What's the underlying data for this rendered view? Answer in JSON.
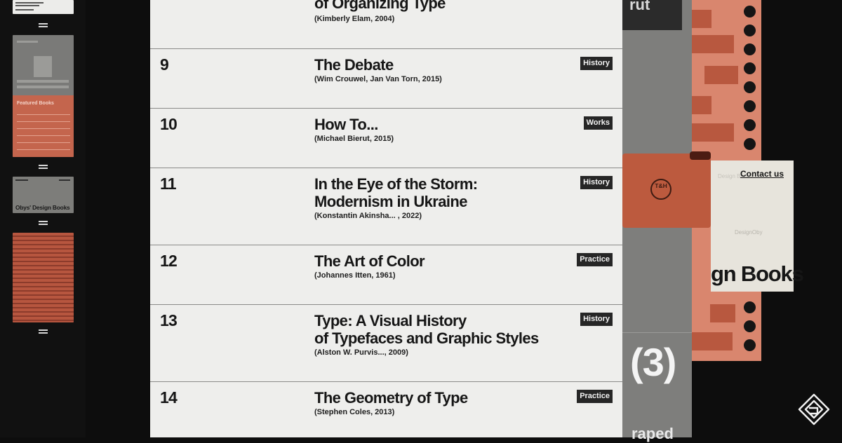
{
  "rail": {
    "thumb3_title": "Obys' Design Books",
    "thumb2_heading": "Featured Books"
  },
  "list": {
    "top": {
      "title": "of Organizing Type",
      "meta": "(Kimberly Elam, 2004)"
    },
    "books": [
      {
        "num": "9",
        "title": "The Debate",
        "meta": "(Wim Crouwel, Jan Van Torn, 2015)",
        "tag": "History"
      },
      {
        "num": "10",
        "title": "How To...",
        "meta": "(Michael Bierut, 2015)",
        "tag": "Works"
      },
      {
        "num": "11",
        "title": "In the Eye of the Storm:\nModernism in Ukraine",
        "meta": "(Konstantin Akinsha... , 2022)",
        "tag": "History"
      },
      {
        "num": "12",
        "title": "The Art of Color",
        "meta": "(Johannes Itten, 1961)",
        "tag": "Practice"
      },
      {
        "num": "13",
        "title": "Type: A Visual History\nof Typefaces and Graphic Styles",
        "meta": "(Alston W. Purvis..., 2009)",
        "tag": "History"
      },
      {
        "num": "14",
        "title": "The Geometry of Type",
        "meta": "(Stephen Coles, 2013)",
        "tag": "Practice"
      }
    ]
  },
  "collage": {
    "dark_card_text": "rut",
    "big_number": "(3)",
    "bottom_word": "raped",
    "logo_text": "T&H",
    "contact_link": "Contact us",
    "headline": "gn Books"
  },
  "colors": {
    "list_bg": "#eeeeec",
    "tag_bg": "#262626",
    "accent_orange": "#bc5a3e"
  }
}
